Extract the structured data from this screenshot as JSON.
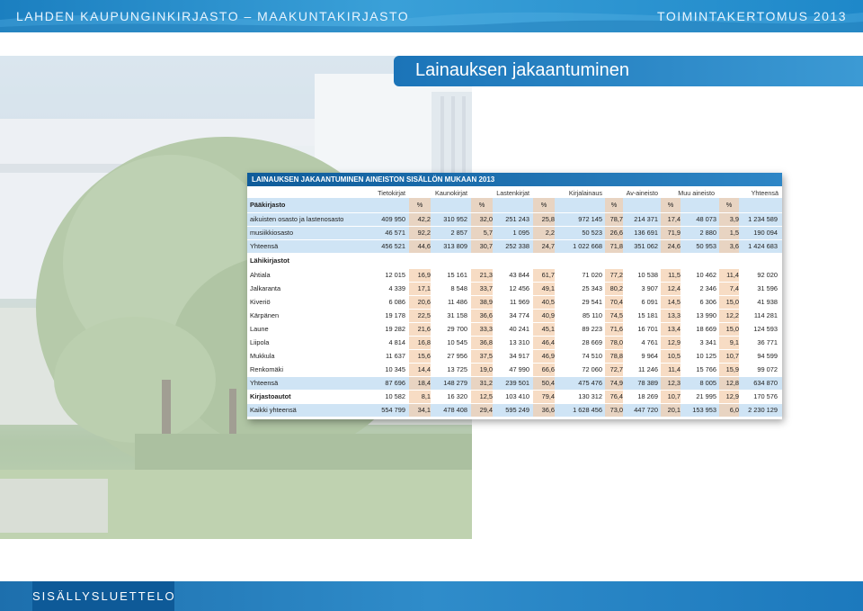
{
  "header": {
    "left": "LAHDEN KAUPUNGINKIRJASTO – MAAKUNTAKIRJASTO",
    "right": "TOIMINTAKERTOMUS 2013"
  },
  "page_title": "Lainauksen jakaantuminen",
  "table": {
    "title": "LAINAUKSEN JAKAANTUMINEN AINEISTON SISÄLLÖN MUKAAN 2013",
    "groups": [
      "Tietokirjat",
      "Kaunokirjat",
      "Lastenkirjat",
      "Kirjalainaus",
      "Av-aineisto",
      "Muu aineisto",
      "Yhteensä"
    ],
    "pct_label": "%",
    "sections": [
      {
        "name": "Pääkirjasto",
        "rows": [
          {
            "label": "aikuisten osasto ja lastenosasto",
            "style": "blue",
            "values": [
              "409 950",
              "42,2",
              "310 952",
              "32,0",
              "251 243",
              "25,8",
              "972 145",
              "78,7",
              "214 371",
              "17,4",
              "48 073",
              "3,9",
              "1 234 589"
            ]
          },
          {
            "label": "musiikkiosasto",
            "style": "blue",
            "values": [
              "46 571",
              "92,2",
              "2 857",
              "5,7",
              "1 095",
              "2,2",
              "50 523",
              "26,6",
              "136 691",
              "71,9",
              "2 880",
              "1,5",
              "190 094"
            ]
          },
          {
            "label": "Yhteensä",
            "style": "blue",
            "values": [
              "456 521",
              "44,6",
              "313 809",
              "30,7",
              "252 338",
              "24,7",
              "1 022 668",
              "71,8",
              "351 062",
              "24,6",
              "50 953",
              "3,6",
              "1 424 683"
            ]
          }
        ]
      },
      {
        "name": "Lähikirjastot",
        "rows": [
          {
            "label": "Ahtiala",
            "style": "plain",
            "values": [
              "12 015",
              "16,9",
              "15 161",
              "21,3",
              "43 844",
              "61,7",
              "71 020",
              "77,2",
              "10 538",
              "11,5",
              "10 462",
              "11,4",
              "92 020"
            ]
          },
          {
            "label": "Jalkaranta",
            "style": "plain",
            "values": [
              "4 339",
              "17,1",
              "8 548",
              "33,7",
              "12 456",
              "49,1",
              "25 343",
              "80,2",
              "3 907",
              "12,4",
              "2 346",
              "7,4",
              "31 596"
            ]
          },
          {
            "label": "Kiveriö",
            "style": "plain",
            "values": [
              "6 086",
              "20,6",
              "11 486",
              "38,9",
              "11 969",
              "40,5",
              "29 541",
              "70,4",
              "6 091",
              "14,5",
              "6 306",
              "15,0",
              "41 938"
            ]
          },
          {
            "label": "Kärpänen",
            "style": "plain",
            "values": [
              "19 178",
              "22,5",
              "31 158",
              "36,6",
              "34 774",
              "40,9",
              "85 110",
              "74,5",
              "15 181",
              "13,3",
              "13 990",
              "12,2",
              "114 281"
            ]
          },
          {
            "label": "Laune",
            "style": "plain",
            "values": [
              "19 282",
              "21,6",
              "29 700",
              "33,3",
              "40 241",
              "45,1",
              "89 223",
              "71,6",
              "16 701",
              "13,4",
              "18 669",
              "15,0",
              "124 593"
            ]
          },
          {
            "label": "Liipola",
            "style": "plain",
            "values": [
              "4 814",
              "16,8",
              "10 545",
              "36,8",
              "13 310",
              "46,4",
              "28 669",
              "78,0",
              "4 761",
              "12,9",
              "3 341",
              "9,1",
              "36 771"
            ]
          },
          {
            "label": "Mukkula",
            "style": "plain",
            "values": [
              "11 637",
              "15,6",
              "27 956",
              "37,5",
              "34 917",
              "46,9",
              "74 510",
              "78,8",
              "9 964",
              "10,5",
              "10 125",
              "10,7",
              "94 599"
            ]
          },
          {
            "label": "Renkomäki",
            "style": "plain",
            "values": [
              "10 345",
              "14,4",
              "13 725",
              "19,0",
              "47 990",
              "66,6",
              "72 060",
              "72,7",
              "11 246",
              "11,4",
              "15 766",
              "15,9",
              "99 072"
            ]
          },
          {
            "label": "Yhteensä",
            "style": "blue",
            "values": [
              "87 696",
              "18,4",
              "148 279",
              "31,2",
              "239 501",
              "50,4",
              "475 476",
              "74,9",
              "78 389",
              "12,3",
              "8 005",
              "12,8",
              "634 870"
            ]
          },
          {
            "label": "Kirjastoautot",
            "style": "plain",
            "bold": true,
            "values": [
              "10 582",
              "8,1",
              "16 320",
              "12,5",
              "103 410",
              "79,4",
              "130 312",
              "76,4",
              "18 269",
              "10,7",
              "21 995",
              "12,9",
              "170 576"
            ]
          },
          {
            "label": "Kaikki yhteensä",
            "style": "blue",
            "values": [
              "554 799",
              "34,1",
              "478 408",
              "29,4",
              "595 249",
              "36,6",
              "1 628 456",
              "73,0",
              "447 720",
              "20,1",
              "153 953",
              "6,0",
              "2 230 129"
            ]
          }
        ]
      }
    ]
  },
  "footer": {
    "toc_button": "SISÄLLYSLUETTELO"
  }
}
